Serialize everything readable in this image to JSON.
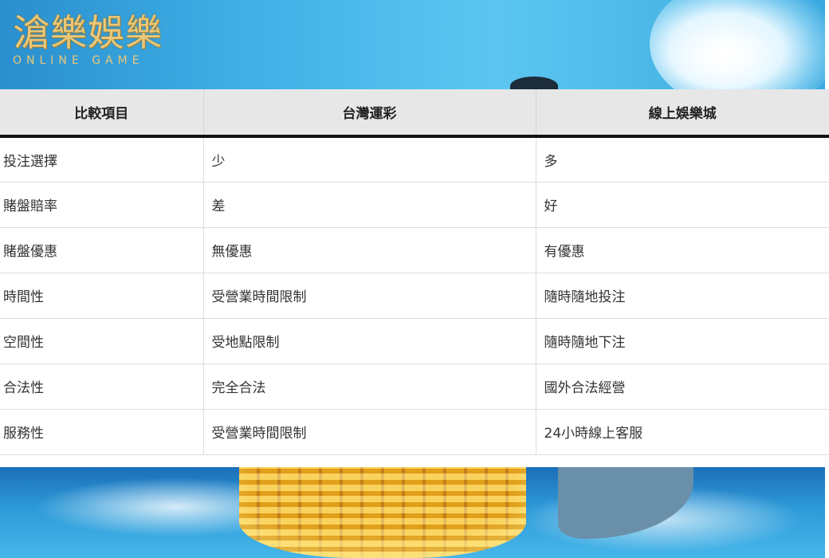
{
  "logo": {
    "title": "滄樂娛樂",
    "subtitle": "ONLINE GAME"
  },
  "table": {
    "headers": [
      "比較項目",
      "台灣運彩",
      "線上娛樂城"
    ],
    "rows": [
      [
        "投注選擇",
        "少",
        "多"
      ],
      [
        "賭盤賠率",
        "差",
        "好"
      ],
      [
        "賭盤優惠",
        "無優惠",
        "有優惠"
      ],
      [
        "時間性",
        "受營業時間限制",
        "隨時隨地投注"
      ],
      [
        "空間性",
        "受地點限制",
        "隨時隨地下注"
      ],
      [
        "合法性",
        "完全合法",
        "國外合法經營"
      ],
      [
        "服務性",
        "受營業時間限制",
        "24小時線上客服"
      ]
    ]
  }
}
